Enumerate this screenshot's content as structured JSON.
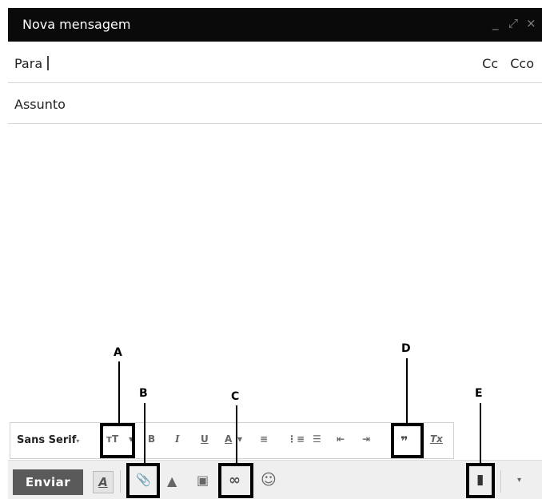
{
  "window": {
    "title": "Nova mensagem",
    "minimize": "_",
    "expand": "⤢",
    "close": "×"
  },
  "fields": {
    "to_label": "Para",
    "cc_label": "Cc",
    "bcc_label": "Cco",
    "subject_placeholder": "Assunto"
  },
  "format_toolbar": {
    "font": "Sans Serif",
    "font_dropdown": "▾",
    "size": "ᴛT",
    "bold": "B",
    "italic": "I",
    "underline": "U",
    "text_color": "A",
    "align": "≡",
    "numbered_list": "⋮≡",
    "bulleted_list": "☰",
    "indent_less": "⇤",
    "indent_more": "⇥",
    "quote": "❞",
    "remove_formatting": "Tx"
  },
  "bottom_toolbar": {
    "send": "Enviar",
    "formatting": "A",
    "attach": "📎",
    "drive": "▲",
    "photo": "▣",
    "link": "∞",
    "emoji": "☺",
    "discard": "▮",
    "more": "▾"
  },
  "callouts": {
    "a": "A",
    "b": "B",
    "c": "C",
    "d": "D",
    "e": "E"
  }
}
